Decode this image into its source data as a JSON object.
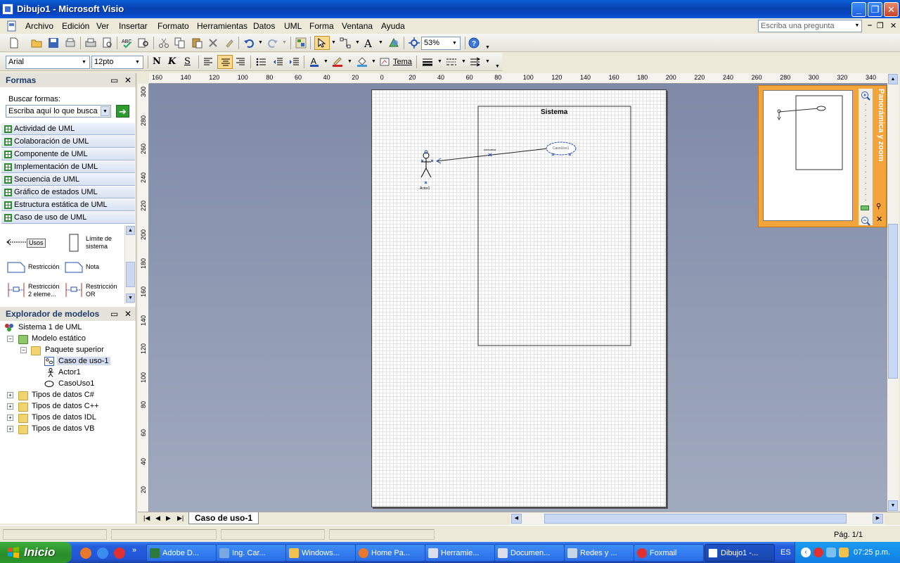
{
  "window": {
    "title": "Dibujo1 - Microsoft Visio"
  },
  "menu": {
    "items": [
      "Archivo",
      "Edición",
      "Ver",
      "Insertar",
      "Formato",
      "Herramientas",
      "Datos",
      "UML",
      "Forma",
      "Ventana",
      "Ayuda"
    ],
    "ask_placeholder": "Escriba una pregunta"
  },
  "toolbar": {
    "zoom": "53%",
    "font": "Arial",
    "font_size": "12pto",
    "bold": "N",
    "italic": "K",
    "underline": "S",
    "theme": "Tema"
  },
  "shapes_panel": {
    "title": "Formas",
    "search_label": "Buscar formas:",
    "search_placeholder": "Escriba aquí lo que busca",
    "stencils": [
      "Actividad de UML",
      "Colaboración de UML",
      "Componente de UML",
      "Implementación de UML",
      "Secuencia de UML",
      "Gráfico de estados UML",
      "Estructura estática de UML",
      "Caso de uso de UML"
    ],
    "shapes": {
      "usos": "Usos",
      "limite_1": "Límite de",
      "limite_2": "sistema",
      "restriccion": "Restricción",
      "nota": "Nota",
      "r2_1": "Restricción",
      "r2_2": "2 eleme...",
      "ror_1": "Restricción",
      "ror_2": "OR"
    }
  },
  "model_explorer": {
    "title": "Explorador de modelos",
    "items": {
      "root": "Sistema 1 de UML",
      "static_model": "Modelo estático",
      "top_package": "Paquete superior",
      "use_case_diagram": "Caso de uso-1",
      "actor": "Actor1",
      "use_case": "CasoUso1",
      "cs_types": "Tipos de datos C#",
      "cpp_types": "Tipos de datos C++",
      "idl_types": "Tipos de datos IDL",
      "vb_types": "Tipos de datos VB"
    }
  },
  "drawing": {
    "system_label": "Sistema",
    "actor_label": "Actor1",
    "usecase_label": "CasoUso1",
    "association_label": "comunica"
  },
  "rulers": {
    "h": [
      "160",
      "140",
      "120",
      "100",
      "80",
      "60",
      "40",
      "20",
      "0",
      "20",
      "40",
      "60",
      "80",
      "100",
      "120",
      "140",
      "160",
      "180",
      "200",
      "220",
      "240",
      "260",
      "280",
      "300",
      "320",
      "340",
      "36"
    ],
    "v": [
      "300",
      "280",
      "260",
      "240",
      "220",
      "200",
      "180",
      "160",
      "140",
      "120",
      "100",
      "80",
      "60",
      "40",
      "20",
      "0"
    ]
  },
  "panzoom": {
    "title": "Panorámica y zoom"
  },
  "sheet_tab": "Caso de uso-1",
  "status": {
    "page": "Pág. 1/1"
  },
  "taskbar": {
    "start": "Inicio",
    "tasks": [
      "Adobe D...",
      "Ing. Car...",
      "Windows...",
      "Home Pa...",
      "Herramie...",
      "Documen...",
      "Redes y ...",
      "Foxmail",
      "Dibujo1 -..."
    ],
    "lang": "ES",
    "clock": "07:25 p.m."
  }
}
